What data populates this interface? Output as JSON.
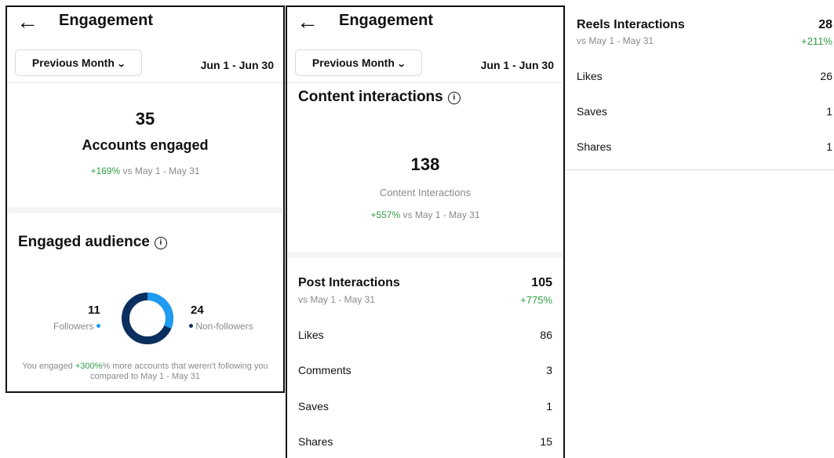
{
  "panel1": {
    "back_icon": "←",
    "title": "Engagement",
    "period_button": "Previous Month",
    "date_range": "Jun 1 - Jun 30",
    "accounts_engaged": {
      "value": "35",
      "label": "Accounts engaged",
      "change": "+169%",
      "compare": "vs May 1 - May 31"
    },
    "engaged_audience": {
      "title": "Engaged audience",
      "followers": {
        "value": "11",
        "label": "Followers",
        "color": "#1f9bf0"
      },
      "non_followers": {
        "value": "24",
        "label": "Non-followers",
        "color": "#0b2f5e"
      },
      "note_prefix": "You engaged ",
      "note_pct": "+300%",
      "note_suffix": "% more accounts that weren't following you",
      "note_line2": "compared to May 1 - May 31"
    }
  },
  "panel2": {
    "back_icon": "←",
    "title": "Engagement",
    "period_button": "Previous Month",
    "date_range": "Jun 1 - Jun 30",
    "content_title": "Content interactions",
    "content": {
      "value": "138",
      "label": "Content Interactions",
      "change": "+557%",
      "compare": "vs May 1 - May 31"
    },
    "post": {
      "title": "Post Interactions",
      "value": "105",
      "compare": "vs May 1 - May 31",
      "change": "+775%",
      "rows": [
        {
          "label": "Likes",
          "value": "86"
        },
        {
          "label": "Comments",
          "value": "3"
        },
        {
          "label": "Saves",
          "value": "1"
        },
        {
          "label": "Shares",
          "value": "15"
        }
      ]
    }
  },
  "panel3": {
    "reels": {
      "title": "Reels Interactions",
      "value": "28",
      "compare": "vs May 1 - May 31",
      "change": "+211%",
      "rows": [
        {
          "label": "Likes",
          "value": "26"
        },
        {
          "label": "Saves",
          "value": "1"
        },
        {
          "label": "Shares",
          "value": "1"
        }
      ]
    }
  },
  "icons": {
    "back": "arrow-left-icon",
    "chevron": "chevron-down-icon",
    "info": "info-icon"
  }
}
